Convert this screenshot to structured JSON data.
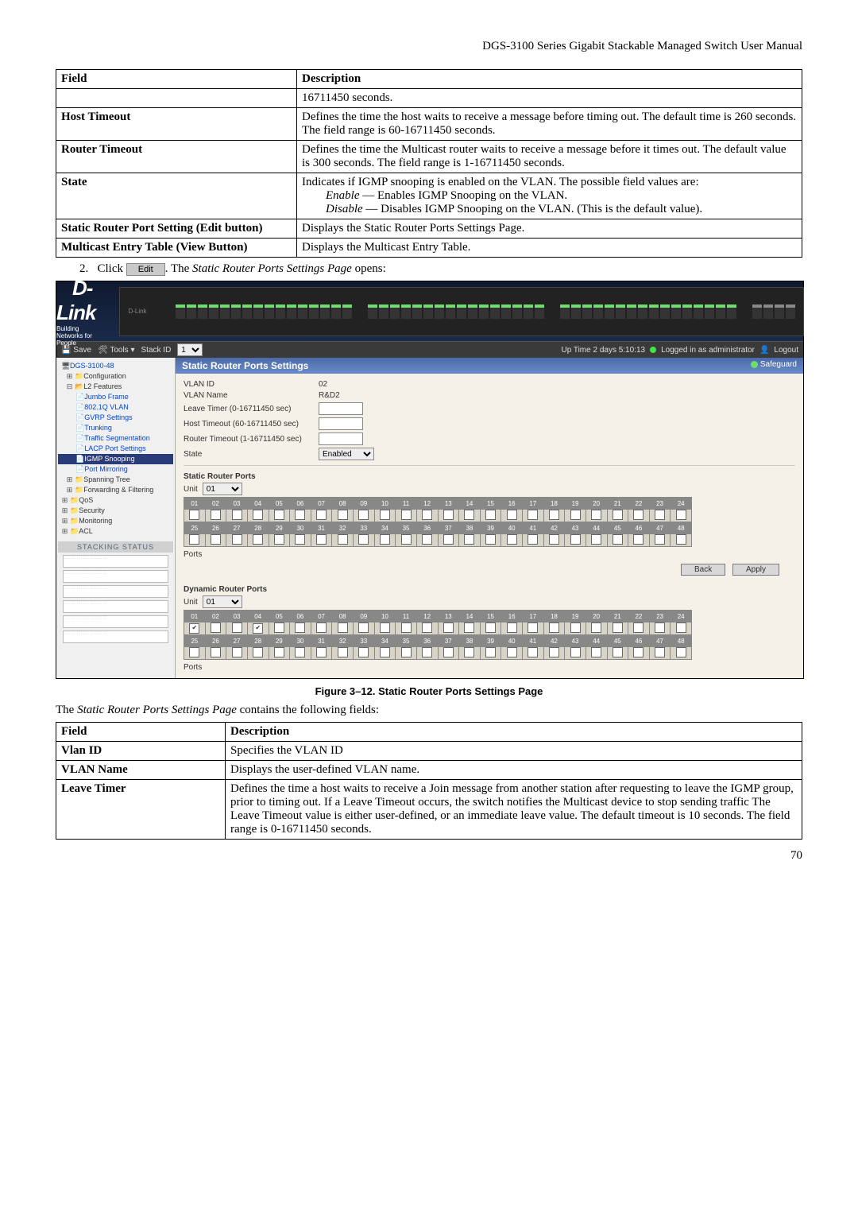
{
  "doc_header": "DGS-3100 Series Gigabit Stackable Managed Switch User Manual",
  "table1": {
    "hdr_field": "Field",
    "hdr_desc": "Description",
    "r0_desc": "16711450 seconds.",
    "r1_field": "Host Timeout",
    "r1_desc": "Defines the time the host waits to receive a message before timing out. The default time is 260 seconds. The field range is 60-16711450 seconds.",
    "r2_field": "Router Timeout",
    "r2_desc": "Defines the time the Multicast router waits to receive a message before it times out. The default value is 300 seconds. The field range is 1-16711450 seconds.",
    "r3_field": "State",
    "r3_desc_p1": "Indicates if IGMP snooping is enabled on the VLAN. The possible field values are:",
    "r3_desc_enable_lbl": "Enable",
    "r3_desc_enable_txt": " — Enables IGMP Snooping on the VLAN.",
    "r3_desc_disable_lbl": "Disable",
    "r3_desc_disable_txt": " — Disables IGMP Snooping on the VLAN. (This is the default value).",
    "r4_field": "Static Router Port Setting (Edit button)",
    "r4_desc": "Displays the Static Router Ports Settings Page.",
    "r5_field": "Multicast Entry Table (View Button)",
    "r5_desc": "Displays the Multicast Entry Table."
  },
  "step": {
    "num": "2.",
    "click": "Click",
    "edit_btn": "Edit",
    "after1": ". The ",
    "page_name": "Static Router Ports Settings Page",
    "after2": " opens:"
  },
  "ui": {
    "brand": "D-Link",
    "brand_sub": "Building Networks for People",
    "menubar": {
      "save": "Save",
      "tools": "Tools",
      "stackid": "Stack ID",
      "stackid_val": "1",
      "uptime": "Up Time 2 days 5:10:13",
      "loggedin": "Logged in as administrator",
      "logout": "Logout"
    },
    "tree": {
      "root": "DGS-3100-48",
      "configuration": "Configuration",
      "l2": "L2 Features",
      "jumbo": "Jumbo Frame",
      "dot1q": "802.1Q VLAN",
      "gvrp": "GVRP Settings",
      "trunking": "Trunking",
      "trafficseg": "Traffic Segmentation",
      "lacp": "LACP Port Settings",
      "igmp": "IGMP Snooping",
      "portmirror": "Port Mirroring",
      "spanning": "Spanning Tree",
      "fwdfilter": "Forwarding & Filtering",
      "qos": "QoS",
      "security": "Security",
      "monitoring": "Monitoring",
      "acl": "ACL",
      "stacking": "STACKING STATUS"
    },
    "panel": {
      "title": "Static Router Ports Settings",
      "safeguard": "Safeguard",
      "vlanid_lbl": "VLAN ID",
      "vlanid_val": "02",
      "vlanname_lbl": "VLAN Name",
      "vlanname_val": "R&D2",
      "leave_lbl": "Leave Timer (0-16711450 sec)",
      "host_lbl": "Host Timeout (60-16711450 sec)",
      "router_lbl": "Router Timeout (1-16711450 sec)",
      "state_lbl": "State",
      "state_val": "Enabled",
      "static_ports": "Static Router Ports",
      "dynamic_ports": "Dynamic Router Ports",
      "unit": "Unit",
      "unit_val": "01",
      "ports": "Ports",
      "back": "Back",
      "apply": "Apply"
    }
  },
  "caption": "Figure 3–12. Static Router Ports Settings Page",
  "following_p1": "The ",
  "following_italic": "Static Router Ports Settings Page",
  "following_p2": " contains the following fields:",
  "table2": {
    "hdr_field": "Field",
    "hdr_desc": "Description",
    "r1_field": "Vlan ID",
    "r1_desc": "Specifies the VLAN ID",
    "r2_field": "VLAN Name",
    "r2_desc": "Displays the user-defined VLAN name.",
    "r3_field": "Leave Timer",
    "r3_desc": "Defines the time a host waits to receive a Join message from another station after requesting to leave the IGMP group, prior to timing out. If a Leave Timeout occurs, the switch notifies the Multicast device to stop sending traffic The Leave Timeout value is either user-defined, or an immediate leave value. The default timeout is 10 seconds. The field range is 0-16711450 seconds."
  },
  "page_num": "70"
}
